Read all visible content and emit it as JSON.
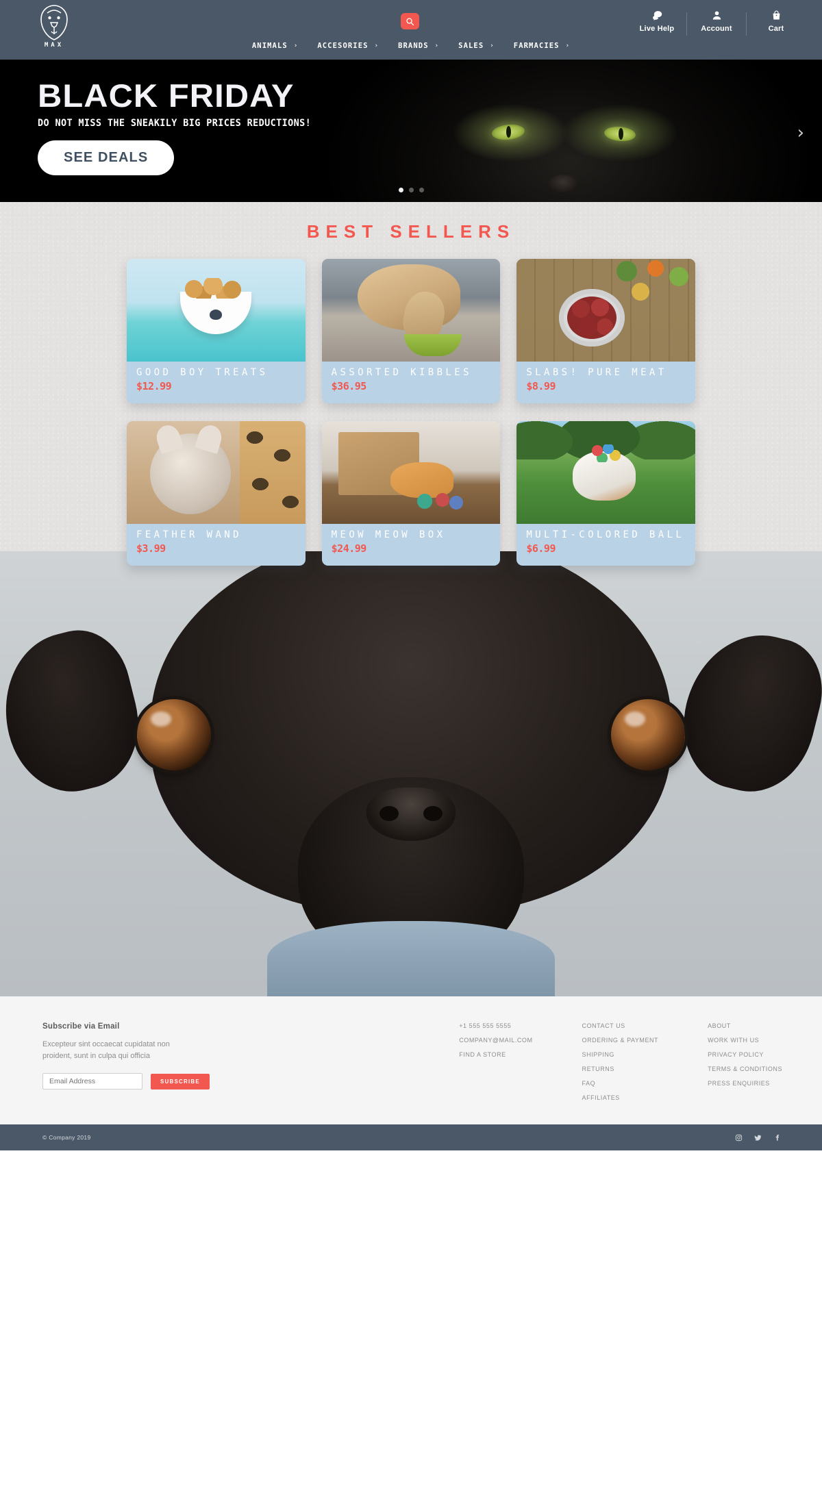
{
  "brand": {
    "name": "MAX",
    "logo_icon": "lion-head-outline-icon"
  },
  "header": {
    "search_icon": "search-icon",
    "nav": [
      {
        "label": "ANIMALS",
        "caret": "›"
      },
      {
        "label": "ACCESORIES",
        "caret": "›"
      },
      {
        "label": "BRANDS",
        "caret": "›"
      },
      {
        "label": "SALES",
        "caret": "›"
      },
      {
        "label": "FARMACIES",
        "caret": "›"
      }
    ],
    "tools": [
      {
        "label": "Live Help",
        "icon": "chat-bubble-icon"
      },
      {
        "label": "Account",
        "icon": "person-icon"
      },
      {
        "label": "Cart",
        "icon": "shopping-bag-icon"
      }
    ]
  },
  "hero": {
    "title": "BLACK FRIDAY",
    "subtitle": "DO NOT MISS THE SNEAKILY BIG PRICES REDUCTIONS!",
    "cta": "SEE DEALS",
    "next_arrow": "›",
    "slides": 3,
    "active_slide": 1
  },
  "best_sellers": {
    "title": "BEST SELLERS",
    "accent_color": "#f2584f",
    "products": [
      {
        "title": "GOOD BOY TREATS",
        "price": "$12.99"
      },
      {
        "title": "ASSORTED KIBBLES",
        "price": "$36.95"
      },
      {
        "title": "SLABS! PURE MEAT",
        "price": "$8.99"
      },
      {
        "title": "FEATHER WAND",
        "price": "$3.99"
      },
      {
        "title": "MEOW MEOW BOX",
        "price": "$24.99"
      },
      {
        "title": "MULTI-COLORED BALL",
        "price": "$6.99"
      }
    ]
  },
  "footer": {
    "subscribe": {
      "title": "Subscribe via Email",
      "text": "Excepteur sint occaecat cupidatat non proident, sunt in culpa qui officia",
      "placeholder": "Email Address",
      "button": "SUBSCRIBE"
    },
    "columns": [
      {
        "links": [
          "+1 555 555 5555",
          "COMPANY@MAIL.COM",
          "FIND A STORE"
        ]
      },
      {
        "links": [
          "CONTACT US",
          "ORDERING & PAYMENT",
          "SHIPPING",
          "RETURNS",
          "FAQ",
          "AFFILIATES"
        ]
      },
      {
        "links": [
          "ABOUT",
          "WORK WITH US",
          "PRIVACY POLICY",
          "TERMS & CONDITIONS",
          "PRESS ENQUIRIES"
        ]
      }
    ],
    "copyright": "© Company 2019",
    "social": [
      "instagram-icon",
      "twitter-icon",
      "facebook-icon"
    ]
  }
}
